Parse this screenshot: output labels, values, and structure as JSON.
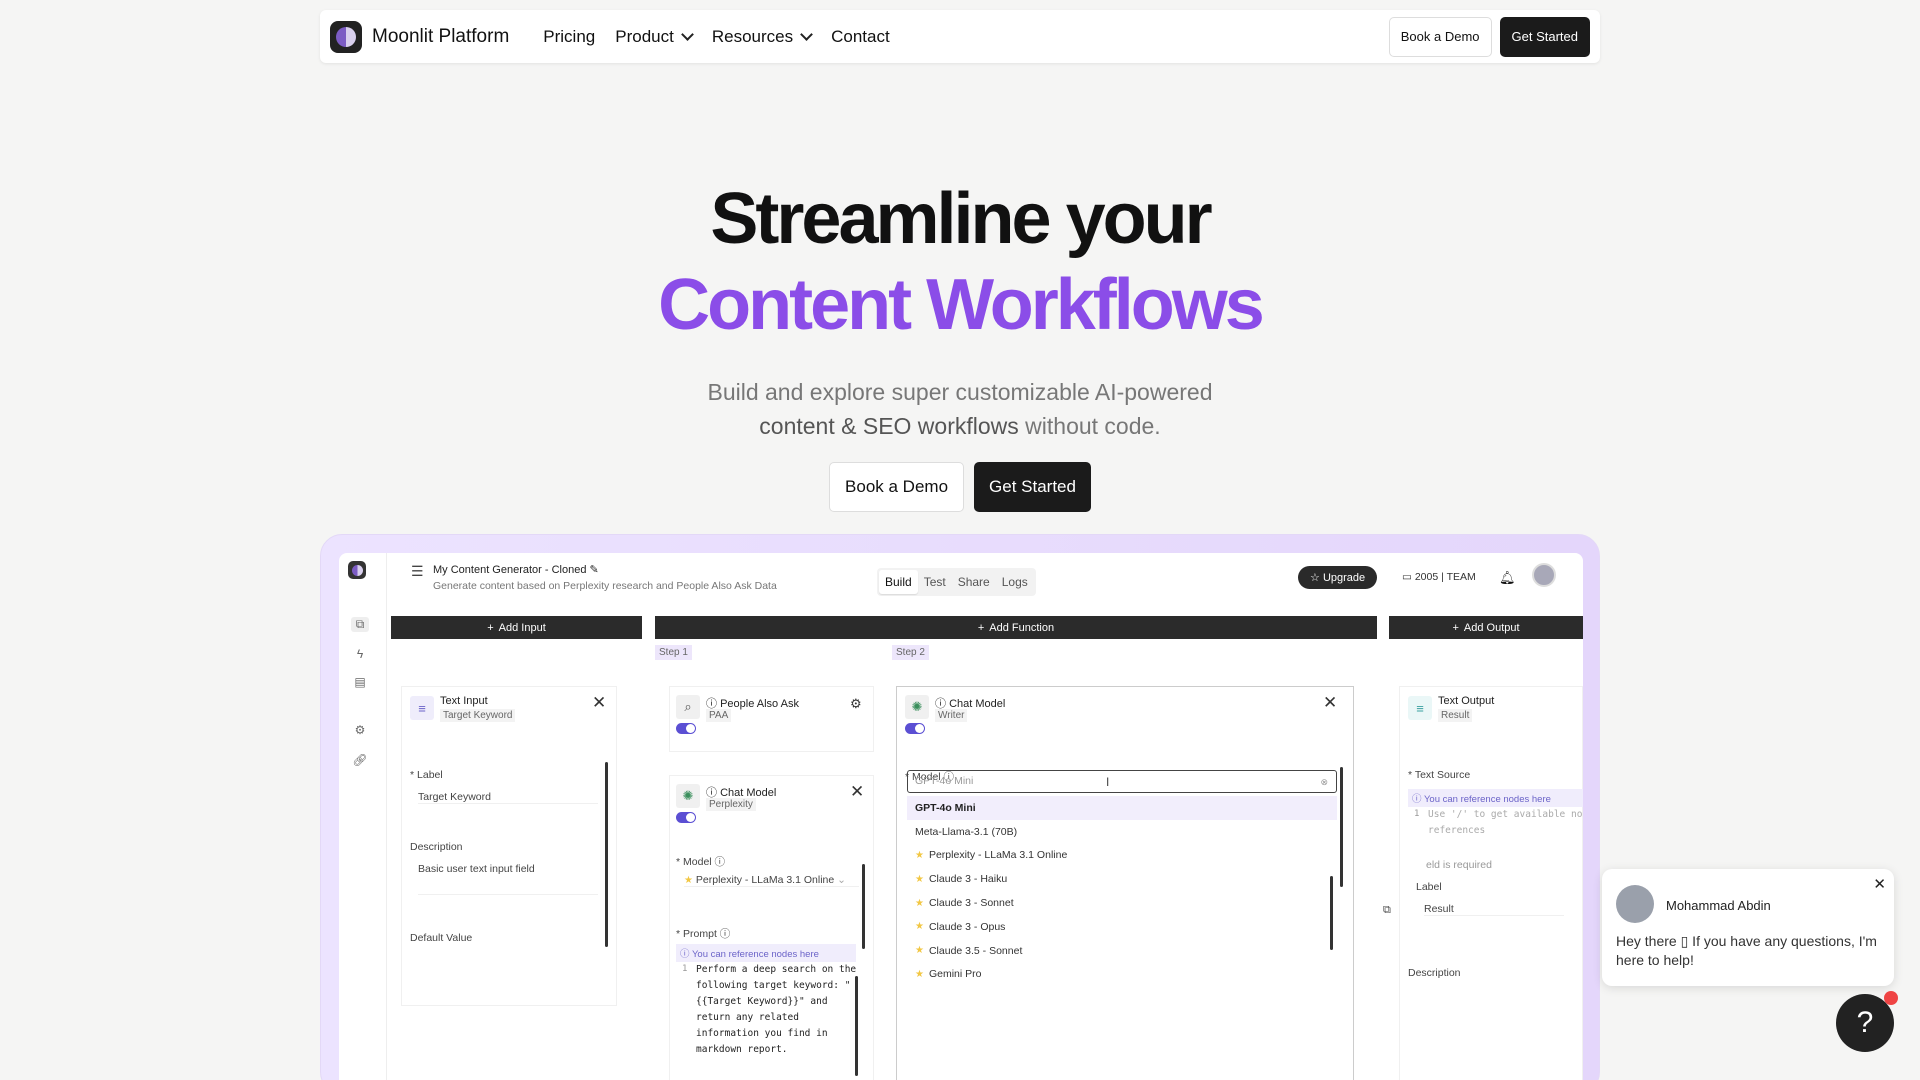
{
  "nav": {
    "brand": "Moonlit Platform",
    "links": [
      "Pricing",
      "Product",
      "Resources",
      "Contact"
    ],
    "book_demo": "Book a Demo",
    "get_started": "Get Started"
  },
  "hero": {
    "line1": "Streamline your",
    "line2": "Content Workflows",
    "sub1": "Build and explore super customizable AI-powered",
    "sub2_highlight": "content & SEO workflows",
    "sub2_rest": " without code.",
    "book_demo": "Book a Demo",
    "get_started": "Get Started"
  },
  "app": {
    "title": "My Content Generator - Cloned",
    "description": "Generate content based on Perplexity research and People Also Ask Data",
    "tabs": [
      "Build",
      "Test",
      "Share",
      "Logs"
    ],
    "active_tab": "Build",
    "upgrade": "Upgrade",
    "credits": "2005 | TEAM",
    "columns": {
      "add_input": "Add Input",
      "add_function": "Add Function",
      "add_output": "Add Output"
    },
    "steps": [
      "Step 1",
      "Step 2"
    ],
    "text_input": {
      "title": "Text Input",
      "sub": "Target Keyword",
      "label_label": "Label",
      "label_value": "Target Keyword",
      "desc_label": "Description",
      "desc_value": "Basic user text input field",
      "default_label": "Default Value"
    },
    "paa": {
      "title": "People Also Ask",
      "sub": "PAA"
    },
    "chat1": {
      "title": "Chat Model",
      "sub": "Perplexity",
      "model_label": "Model",
      "model_value": "Perplexity - LLaMa 3.1 Online",
      "prompt_label": "Prompt",
      "hint": "You can reference nodes here",
      "line_no": "1",
      "code": "Perform a deep search on the\nfollowing target keyword: \"\n{{Target Keyword}}\" and\nreturn any related\ninformation you find in\nmarkdown report."
    },
    "chat2": {
      "title": "Chat Model",
      "sub": "Writer",
      "model_label": "Model",
      "search_placeholder": "GPT-4o Mini",
      "options": [
        {
          "label": "GPT-4o Mini",
          "star": false
        },
        {
          "label": "Meta-Llama-3.1 (70B)",
          "star": false
        },
        {
          "label": "Perplexity - LLaMa 3.1 Online",
          "star": true
        },
        {
          "label": "Claude 3 - Haiku",
          "star": true
        },
        {
          "label": "Claude 3 - Sonnet",
          "star": true
        },
        {
          "label": "Claude 3 - Opus",
          "star": true
        },
        {
          "label": "Claude 3.5 - Sonnet",
          "star": true
        },
        {
          "label": "Gemini Pro",
          "star": true
        }
      ]
    },
    "text_output": {
      "title": "Text Output",
      "sub": "Result",
      "source_label": "Text Source",
      "hint": "You can reference nodes here",
      "line_no": "1",
      "code": "Use '/' to get available no\nreferences",
      "required": "eld is required",
      "label_label": "Label",
      "label_value": "Result",
      "desc_label": "Description"
    }
  },
  "chat_widget": {
    "name": "Mohammad Abdin",
    "message": "Hey there ▯   If you have any questions, I'm here to help!"
  },
  "colors": {
    "accent": "#8b4de8",
    "dark": "#1b1b1b"
  }
}
